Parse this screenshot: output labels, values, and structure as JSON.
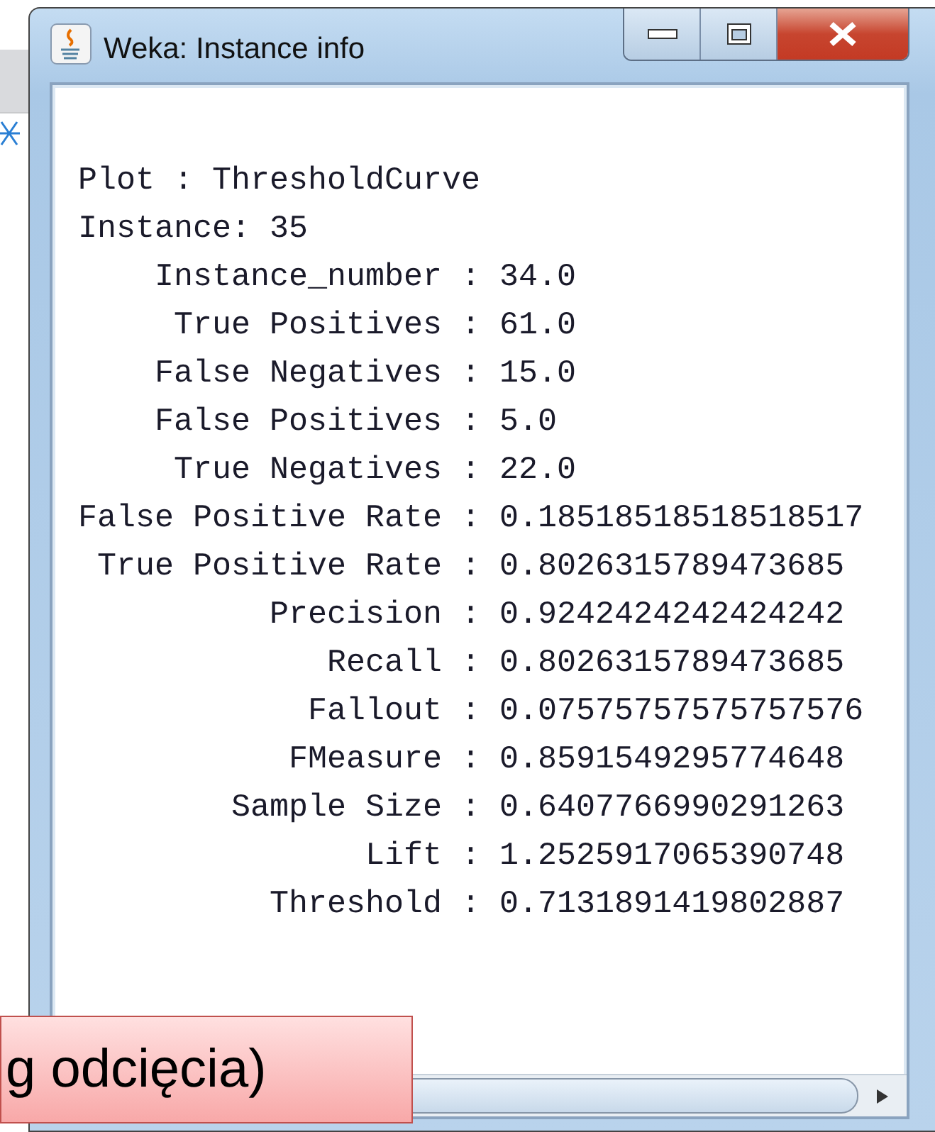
{
  "window": {
    "title": "Weka: Instance info"
  },
  "info": {
    "header": [
      "Plot : ThresholdCurve",
      "Instance: 35"
    ],
    "attributes": [
      {
        "name": "Instance_number :",
        "value": "34.0"
      },
      {
        "name": "True Positives :",
        "value": "61.0"
      },
      {
        "name": "False Negatives :",
        "value": "15.0"
      },
      {
        "name": "False Positives :",
        "value": "5.0"
      },
      {
        "name": "True Negatives :",
        "value": "22.0"
      },
      {
        "name": "False Positive Rate :",
        "value": "0.18518518518518517"
      },
      {
        "name": "True Positive Rate :",
        "value": "0.8026315789473685"
      },
      {
        "name": "Precision :",
        "value": "0.9242424242424242"
      },
      {
        "name": "Recall :",
        "value": "0.8026315789473685"
      },
      {
        "name": "Fallout :",
        "value": "0.07575757575757576"
      },
      {
        "name": "FMeasure :",
        "value": "0.8591549295774648"
      },
      {
        "name": "Sample Size :",
        "value": "0.6407766990291263"
      },
      {
        "name": "Lift :",
        "value": "1.2525917065390748"
      },
      {
        "name": "Threshold :",
        "value": "0.7131891419802887"
      }
    ]
  },
  "callout": {
    "text": "g odcięcia)"
  }
}
